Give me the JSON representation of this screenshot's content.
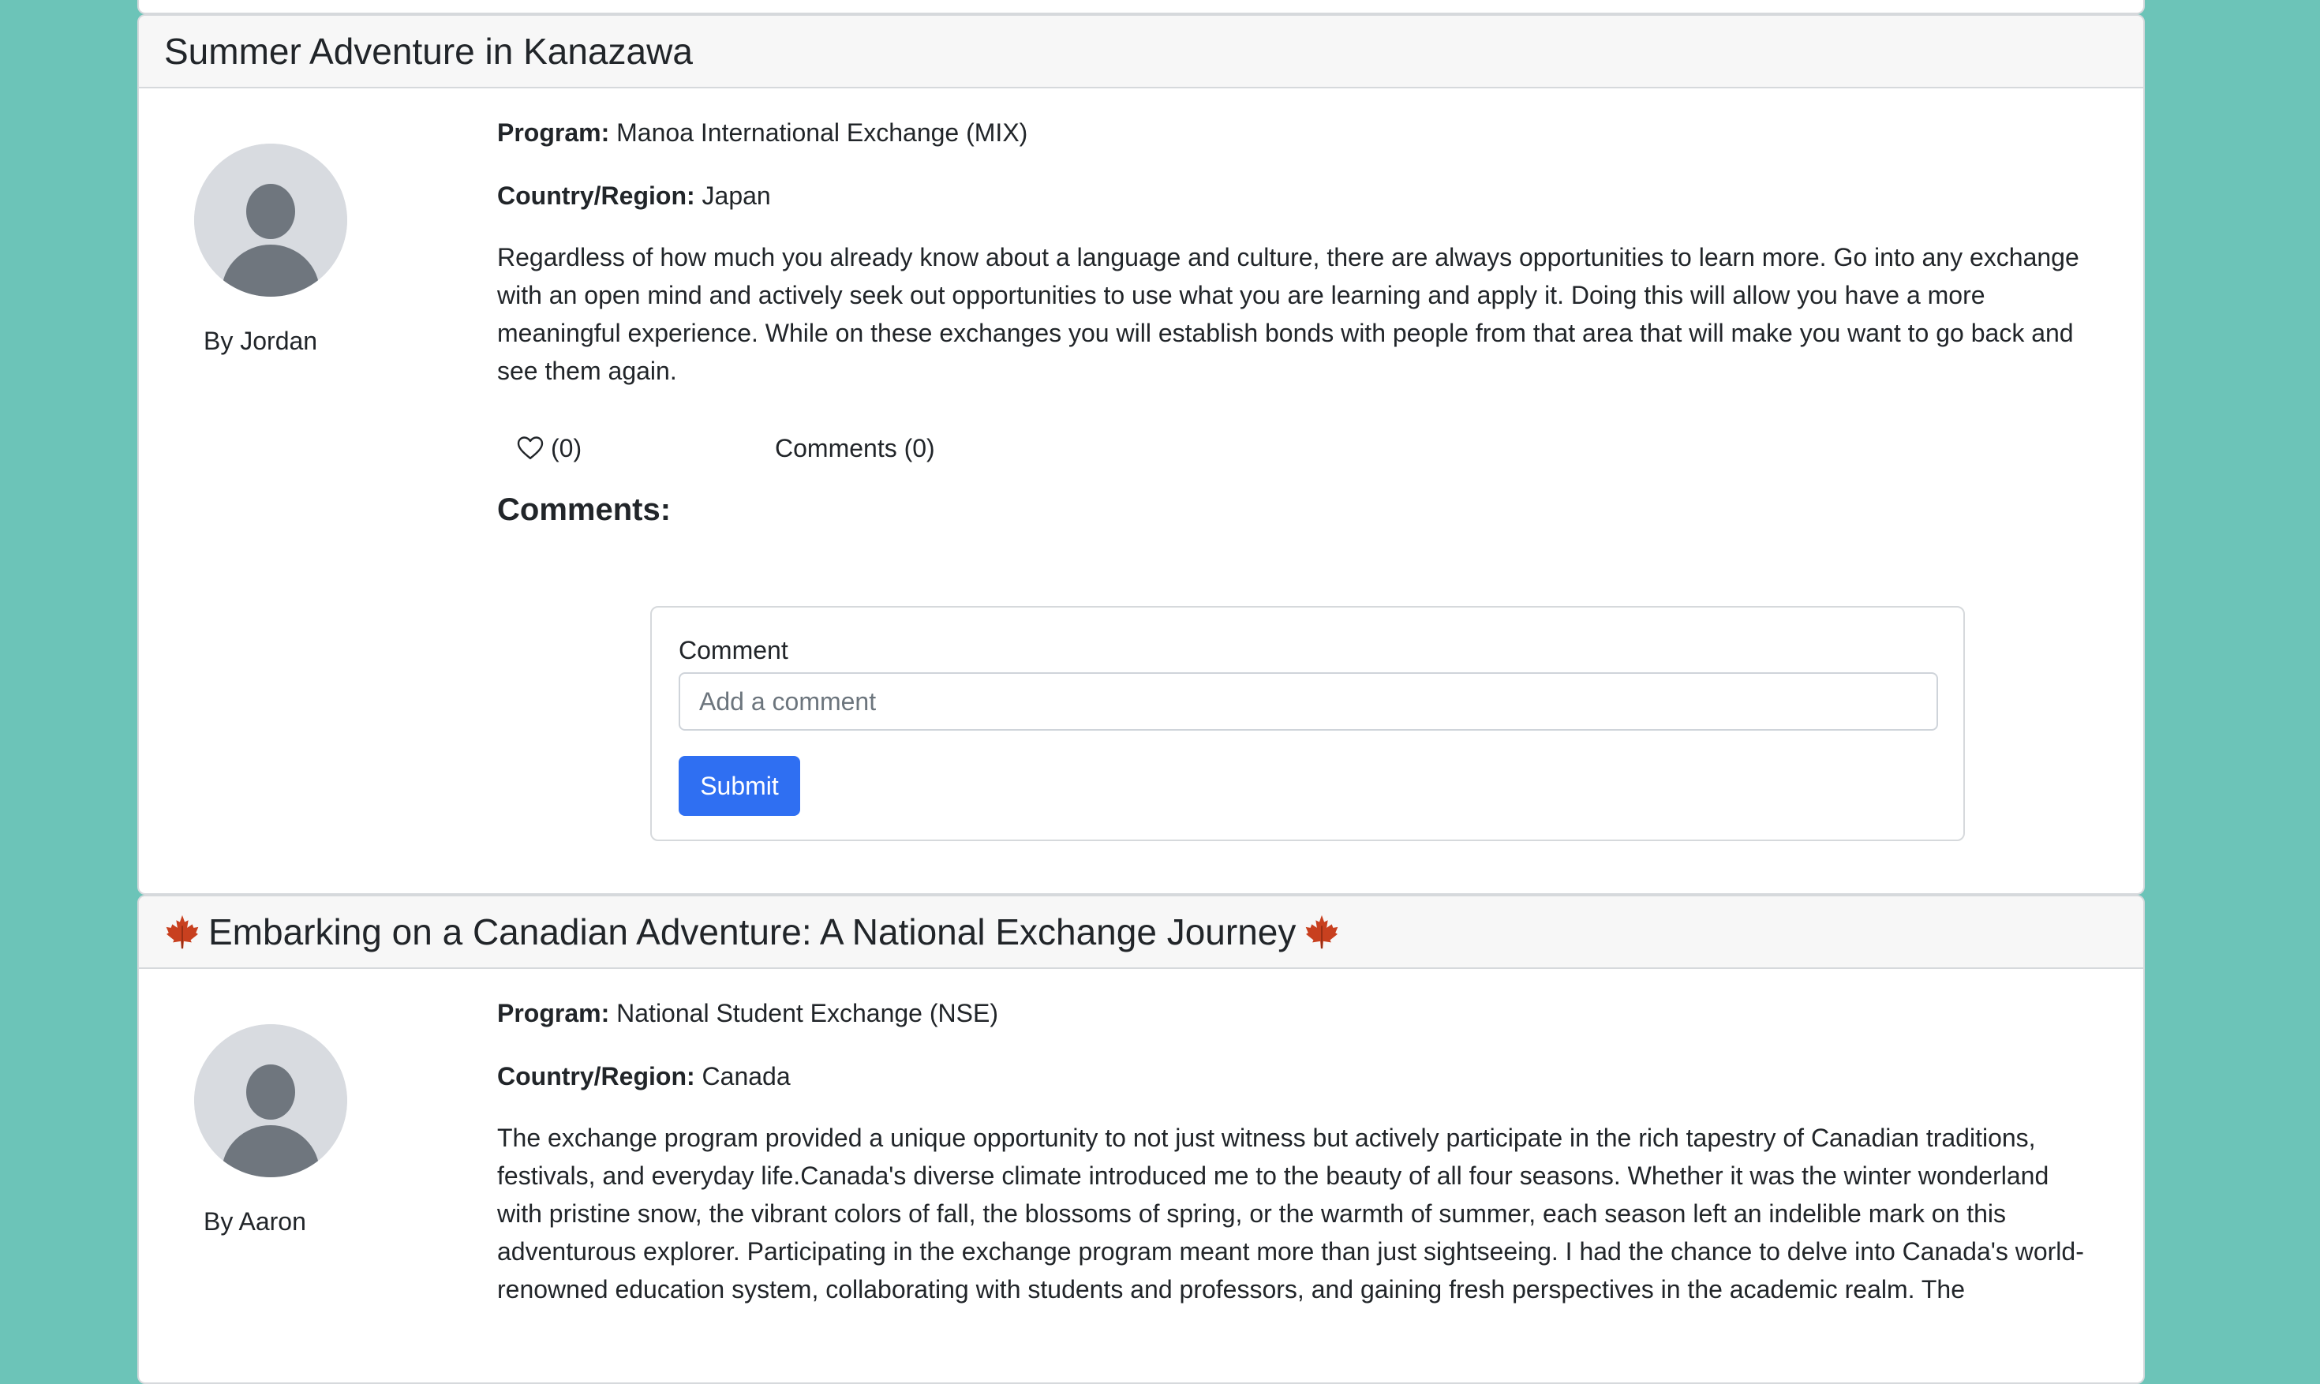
{
  "posts": [
    {
      "title": "Summer Adventure in Kanazawa",
      "author": "By Jordan",
      "program_label": "Program:",
      "program": "Manoa International Exchange (MIX)",
      "country_label": "Country/Region:",
      "country": "Japan",
      "body": "Regardless of how much you already know about a language and culture, there are always opportunities to learn more. Go into any exchange with an open mind and actively seek out opportunities to use what you are learning and apply it. Doing this will allow you have a more meaningful experience. While on these exchanges you will establish bonds with people from that area that will make you want to go back and see them again.",
      "likes": "(0)",
      "comments_link": "Comments (0)",
      "comments_heading": "Comments:",
      "comment_form": {
        "label": "Comment",
        "placeholder": "Add a comment",
        "value": "",
        "submit": "Submit"
      }
    },
    {
      "title": "Embarking on a Canadian Adventure: A National Exchange Journey",
      "title_icon": "maple-leaf-icon",
      "author": "By Aaron",
      "program_label": "Program:",
      "program": "National Student Exchange (NSE)",
      "country_label": "Country/Region:",
      "country": "Canada",
      "body": "The exchange program provided a unique opportunity to not just witness but actively participate in the rich tapestry of Canadian traditions, festivals, and everyday life.Canada's diverse climate introduced me to the beauty of all four seasons. Whether it was the winter wonderland with pristine snow, the vibrant colors of fall, the blossoms of spring, or the warmth of summer, each season left an indelible mark on this adventurous explorer. Participating in the exchange program meant more than just sightseeing. I had the chance to delve into Canada's world-renowned education system, collaborating with students and professors, and gaining fresh perspectives in the academic realm. The"
    }
  ],
  "colors": {
    "background": "#6cc4b8",
    "card_header": "#f7f7f7",
    "primary_button": "#2f6ff2",
    "avatar_bg": "#d8dbe0",
    "avatar_figure": "#6f767e"
  }
}
